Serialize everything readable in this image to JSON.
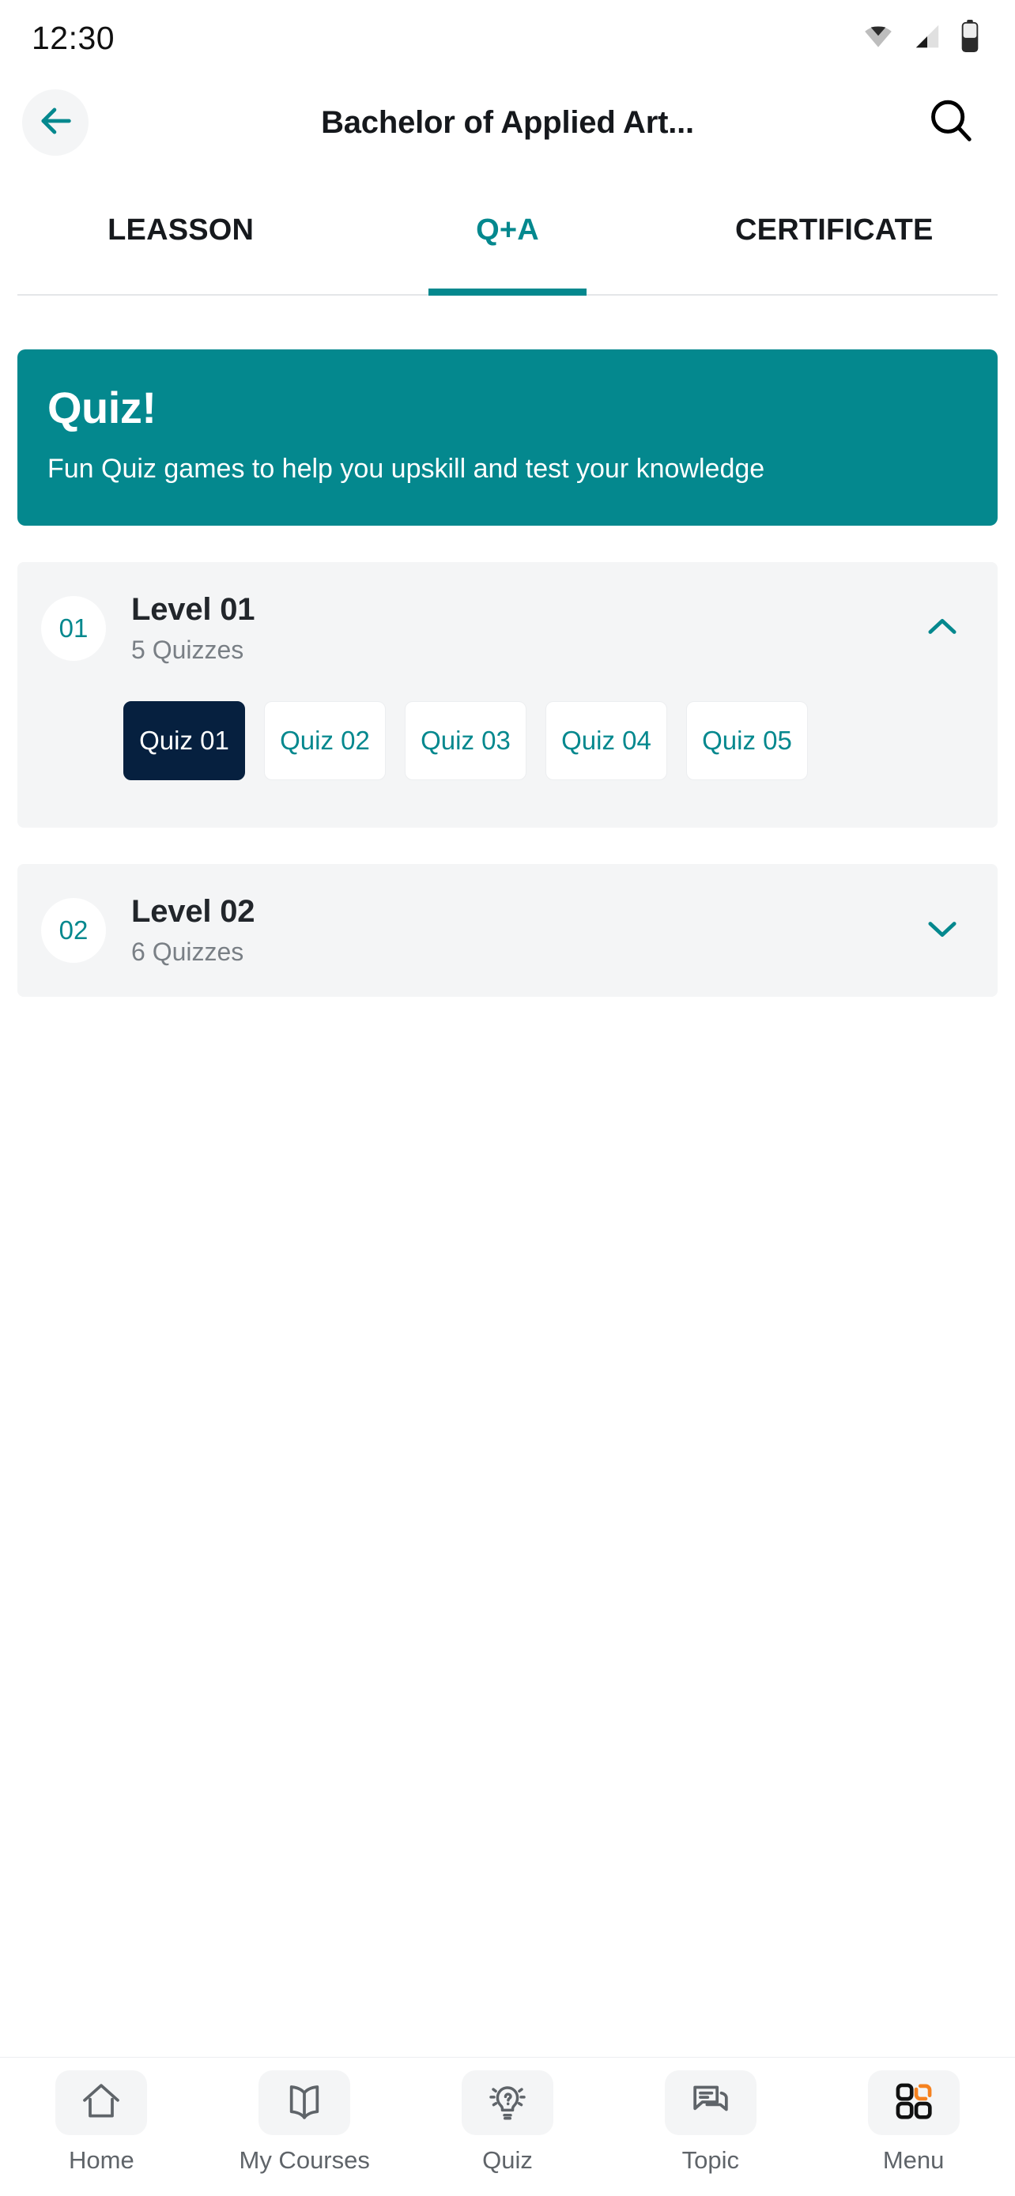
{
  "statusbar": {
    "time": "12:30",
    "icons": [
      "wifi-icon",
      "cellular-signal-icon",
      "battery-icon"
    ]
  },
  "header": {
    "back_icon": "arrow-left-icon",
    "title": "Bachelor of Applied Art...",
    "search_icon": "search-icon"
  },
  "tabs": [
    {
      "label": "LEASSON",
      "active": false
    },
    {
      "label": "Q+A",
      "active": true
    },
    {
      "label": "CERTIFICATE",
      "active": false
    }
  ],
  "banner": {
    "title": "Quiz!",
    "subtitle": "Fun Quiz games to help you upskill and test your knowledge",
    "bg_color": "#04888e"
  },
  "levels": [
    {
      "badge": "01",
      "title": "Level 01",
      "count": "5 Quizzes",
      "expanded": true,
      "chevron_icon": "chevron-up-icon",
      "quizzes": [
        {
          "label": "Quiz 01",
          "selected": true
        },
        {
          "label": "Quiz 02",
          "selected": false
        },
        {
          "label": "Quiz 03",
          "selected": false
        },
        {
          "label": "Quiz 04",
          "selected": false
        },
        {
          "label": "Quiz 05",
          "selected": false
        }
      ]
    },
    {
      "badge": "02",
      "title": "Level 02",
      "count": "6 Quizzes",
      "expanded": false,
      "chevron_icon": "chevron-down-icon",
      "quizzes": []
    }
  ],
  "bottom_nav": [
    {
      "label": "Home",
      "icon": "home-icon"
    },
    {
      "label": "My Courses",
      "icon": "open-book-icon"
    },
    {
      "label": "Quiz",
      "icon": "lightbulb-question-icon"
    },
    {
      "label": "Topic",
      "icon": "chat-bubbles-icon"
    },
    {
      "label": "Menu",
      "icon": "grid-menu-icon"
    }
  ],
  "colors": {
    "accent_teal": "#04888e",
    "selected_navy": "#06203f",
    "menu_accent_orange": "#f58220",
    "card_bg": "#f4f5f6"
  }
}
